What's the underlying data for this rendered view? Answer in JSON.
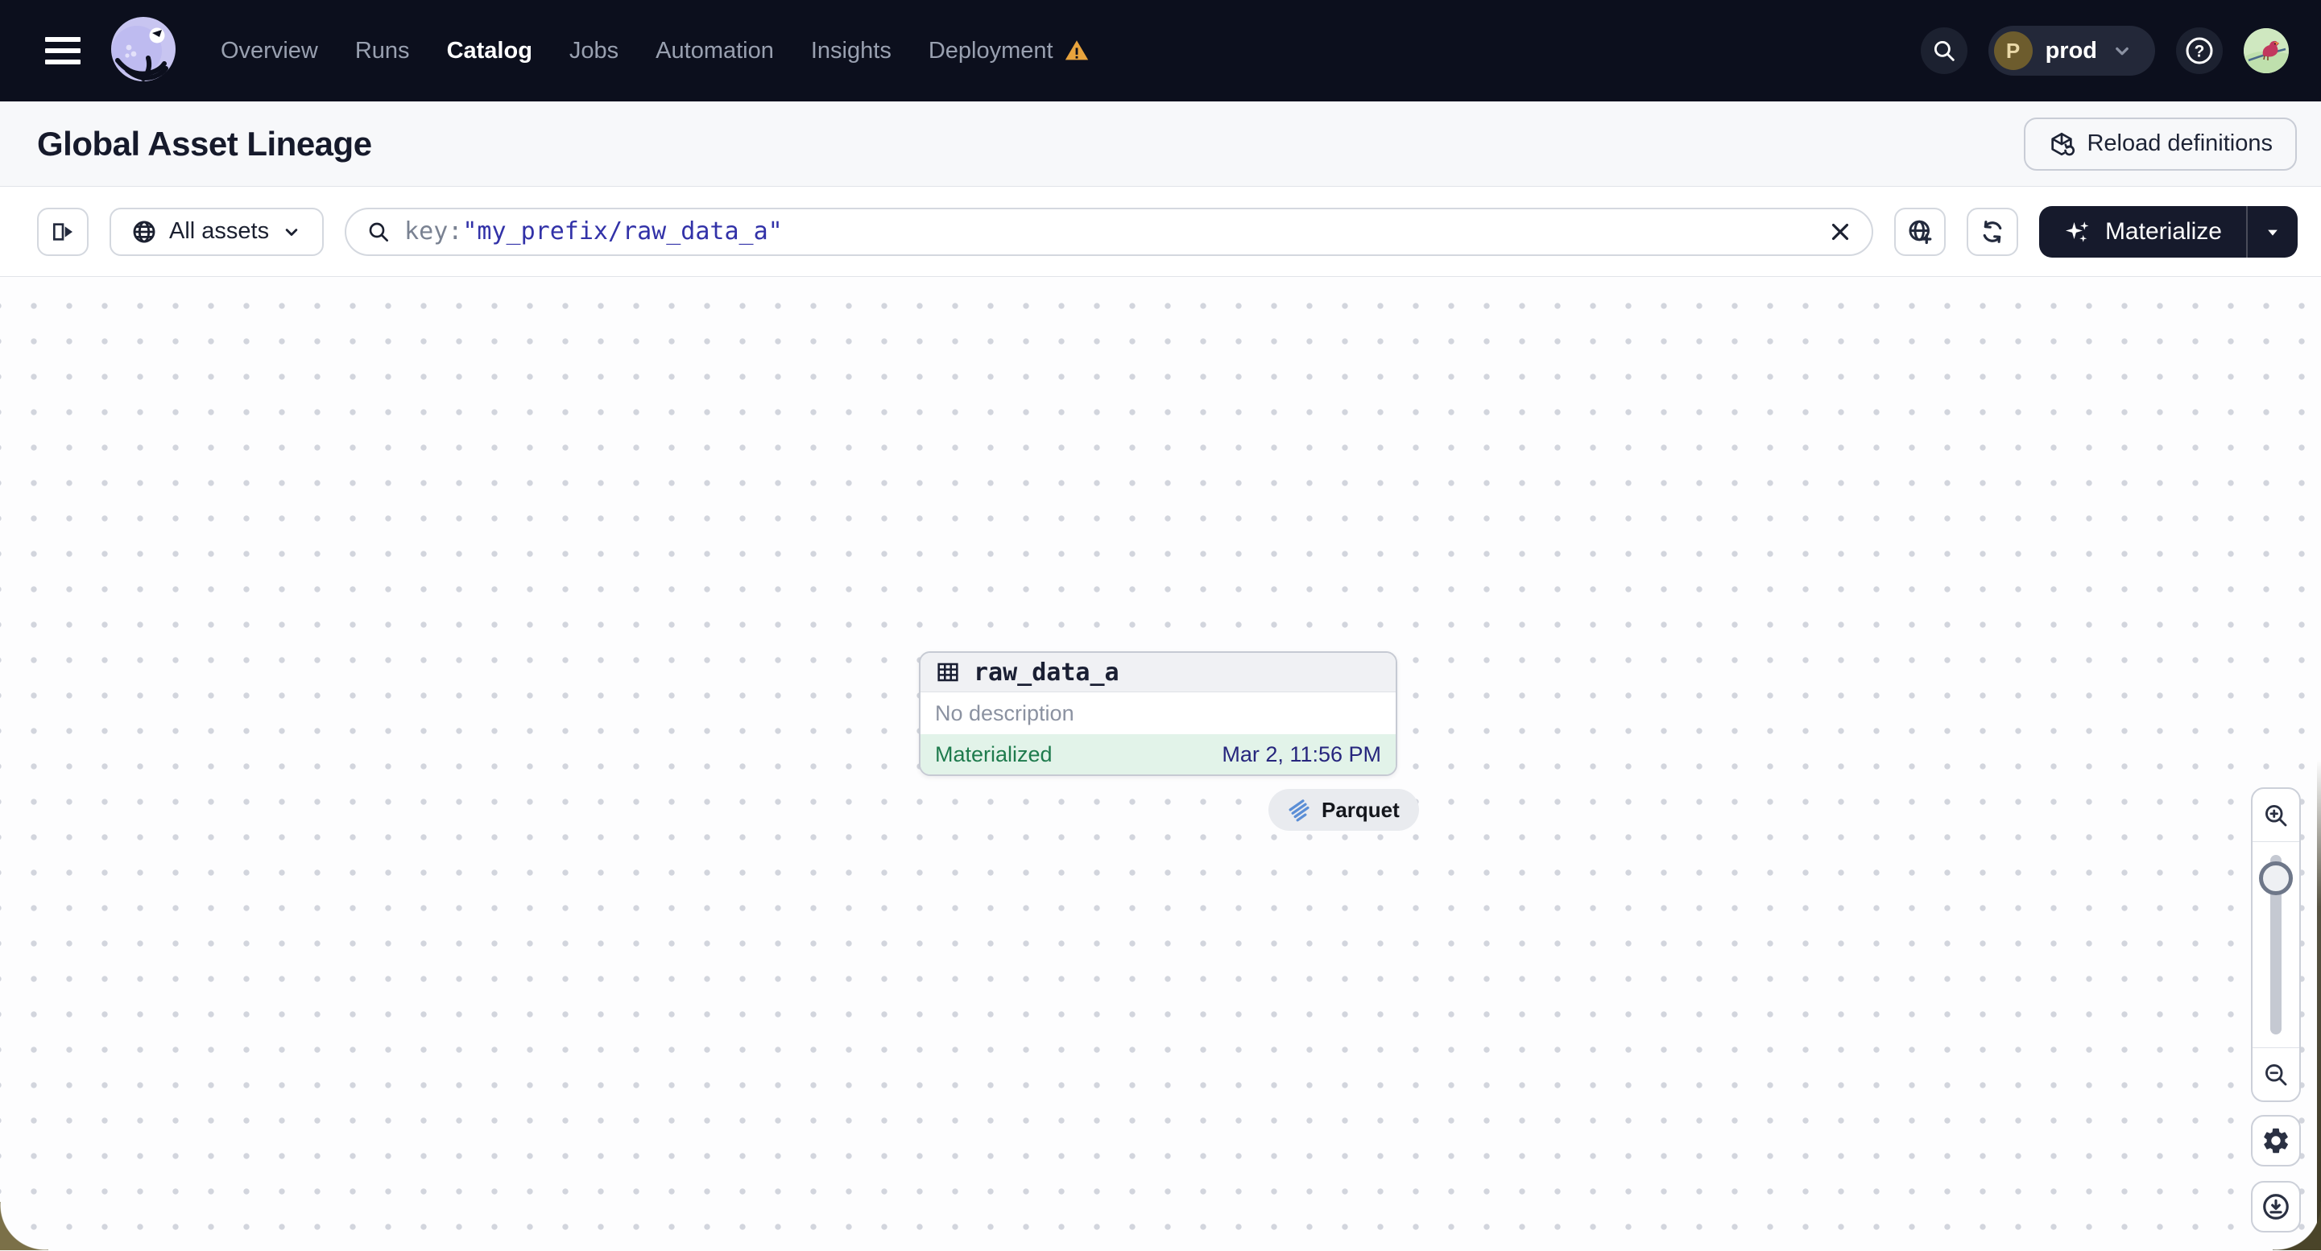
{
  "header": {
    "nav": [
      {
        "label": "Overview"
      },
      {
        "label": "Runs"
      },
      {
        "label": "Catalog"
      },
      {
        "label": "Jobs"
      },
      {
        "label": "Automation"
      },
      {
        "label": "Insights"
      },
      {
        "label": "Deployment"
      }
    ],
    "env": {
      "initial": "P",
      "label": "prod"
    }
  },
  "page": {
    "title": "Global Asset Lineage",
    "reload_button": "Reload definitions"
  },
  "toolbar": {
    "scope_label": "All assets",
    "search_prefix": "key:",
    "search_value": "\"my_prefix/raw_data_a\"",
    "materialize_label": "Materialize"
  },
  "node": {
    "name": "raw_data_a",
    "description": "No description",
    "status": "Materialized",
    "timestamp": "Mar 2, 11:56 PM",
    "tag": "Parquet"
  },
  "icons": {
    "names": [
      "menu-icon",
      "dagster-logo",
      "warning-icon",
      "search-icon",
      "help-icon",
      "reload-definitions-icon",
      "panel-open-icon",
      "globe-icon",
      "chevron-down-icon",
      "clear-icon",
      "globe-add-icon",
      "refresh-icon",
      "sparkles-icon",
      "caret-down-icon",
      "table-icon",
      "parquet-icon",
      "zoom-in-icon",
      "zoom-out-icon",
      "gear-icon",
      "download-icon"
    ]
  },
  "colors": {
    "header_bg": "#0c0f1d",
    "accent_indigo": "#3232a8",
    "status_green": "#1e7b4d",
    "status_green_bg": "#e2f3e9",
    "warning_orange": "#e8a33d",
    "materialize_bg": "#161a2c",
    "logo_lavender": "#c8c5f1"
  }
}
